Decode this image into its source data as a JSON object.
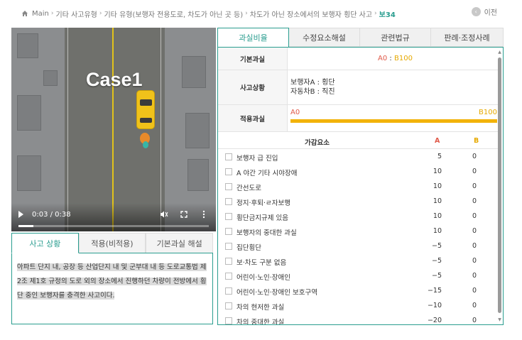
{
  "breadcrumb": {
    "items": [
      "Main",
      "기타 사고유형",
      "기타 유형(보행자 전용도로, 차도가 아닌 곳 등)",
      "차도가 아닌 장소에서의 보행자 횡단 사고"
    ],
    "current": "보34"
  },
  "prev_button": {
    "label": "이전",
    "icon": "arrow-left-circle-icon"
  },
  "video": {
    "overlay_title": "Case1",
    "time": "0:03 / 0:38",
    "progress": 0.079
  },
  "left_tabs": [
    {
      "label": "사고 상황",
      "active": true
    },
    {
      "label": "적용(비적용)",
      "active": false
    },
    {
      "label": "기본과실 해설",
      "active": false
    }
  ],
  "situation_text": "아파트 단지 내, 공장 등 산업단지 내 및 군부대 내 등 도로교통법 제2조 제1호 규정의 도로 외의 장소에서 진행하던 차량이 전방에서 횡단 중인 보행자를 충격한 사고이다.",
  "right_tabs": [
    {
      "label": "과실비율",
      "active": true
    },
    {
      "label": "수정요소해설",
      "active": false
    },
    {
      "label": "관련법규",
      "active": false
    },
    {
      "label": "판례·조정사례",
      "active": false
    }
  ],
  "basic_fault": {
    "label": "기본과실",
    "a": "A0",
    "sep": " : ",
    "b": "B100"
  },
  "situation": {
    "label": "사고상황",
    "line1": "보행자A : 횡단",
    "line2": "자동차B : 직진"
  },
  "applied_fault": {
    "label": "적용과실",
    "a": "A0",
    "b": "B100",
    "b_ratio": 1.0
  },
  "factors_header": {
    "title": "가감요소",
    "col_a": "A",
    "col_b": "B"
  },
  "factors": [
    {
      "name": "보행자 급 진입",
      "a": "5",
      "b": "0"
    },
    {
      "name": "A 야간 기타 시야장애",
      "a": "10",
      "b": "0"
    },
    {
      "name": "간선도로",
      "a": "10",
      "b": "0"
    },
    {
      "name": "정지·후퇴·ㄹ자보행",
      "a": "10",
      "b": "0"
    },
    {
      "name": "횡단금지규제 있음",
      "a": "10",
      "b": "0"
    },
    {
      "name": "보행자의 중대한 과실",
      "a": "10",
      "b": "0"
    },
    {
      "name": "집단횡단",
      "a": "−5",
      "b": "0"
    },
    {
      "name": "보·차도 구분 없음",
      "a": "−5",
      "b": "0"
    },
    {
      "name": "어린이·노인·장애인",
      "a": "−5",
      "b": "0"
    },
    {
      "name": "어린이·노인·장애인 보호구역",
      "a": "−15",
      "b": "0"
    },
    {
      "name": "차의 현저한 과실",
      "a": "−10",
      "b": "0"
    },
    {
      "name": "차의 중대한 과실",
      "a": "−20",
      "b": "0"
    }
  ],
  "colors": {
    "accent": "#2a9d8f",
    "a_color": "#e05a4a",
    "b_color": "#e6a900",
    "bar": "#f2b30a"
  }
}
